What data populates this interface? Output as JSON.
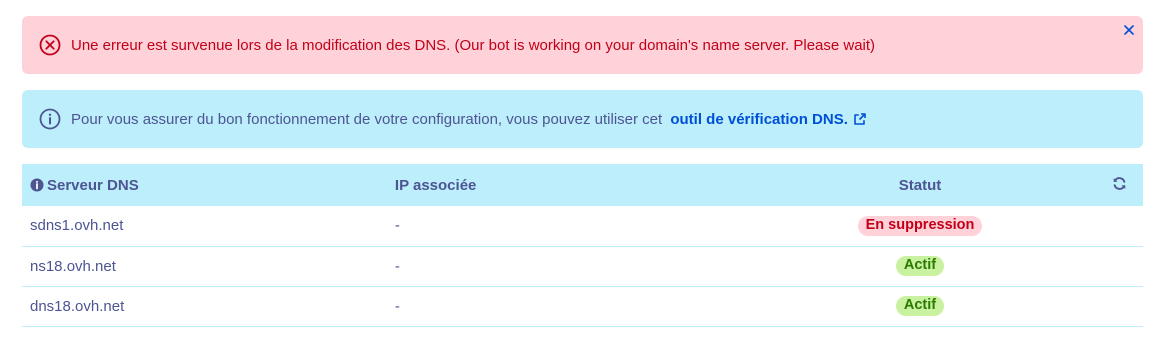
{
  "colors": {
    "error_bg": "#ffd2da",
    "error_text": "#c20017",
    "info_bg": "#bdeefc",
    "info_text": "#4d5592",
    "link": "#0050d7",
    "success_bg": "#c9f2a0",
    "success_text": "#2b7a00"
  },
  "error_alert": {
    "icon": "error-circle-x-icon",
    "message": "Une erreur est survenue lors de la modification des DNS. (Our bot is working on your domain's name server. Please wait)",
    "close_icon": "close-icon"
  },
  "info_alert": {
    "icon": "info-circle-icon",
    "message": "Pour vous assurer du bon fonctionnement de votre configuration, vous pouvez utiliser cet",
    "link_text": "outil de vérification DNS.",
    "link_icon": "external-link-icon"
  },
  "table": {
    "headers": {
      "server": "Serveur DNS",
      "ip": "IP associée",
      "status": "Statut"
    },
    "header_icons": {
      "server": "info-icon",
      "refresh": "refresh-icon"
    },
    "rows": [
      {
        "server": "sdns1.ovh.net",
        "ip": "-",
        "status": "En suppression",
        "status_type": "error"
      },
      {
        "server": "ns18.ovh.net",
        "ip": "-",
        "status": "Actif",
        "status_type": "success"
      },
      {
        "server": "dns18.ovh.net",
        "ip": "-",
        "status": "Actif",
        "status_type": "success"
      }
    ]
  }
}
